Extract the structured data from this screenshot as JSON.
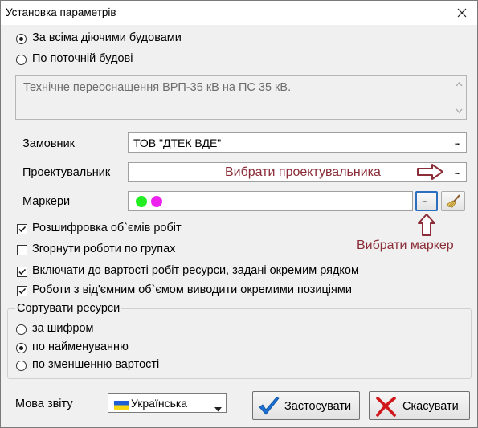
{
  "window": {
    "title": "Установка параметрів"
  },
  "scope": {
    "option_all": "За всіма діючими будовами",
    "option_current": "По поточній будові",
    "selected": "all",
    "description": "Технічне переоснащення ВРП-35 кВ на ПС 35 кВ."
  },
  "fields": {
    "customer_label": "Замовник",
    "customer_value": "ТОВ \"ДТЕК ВДЕ\"",
    "designer_label": "Проектувальник",
    "designer_value": "",
    "markers_label": "Маркери",
    "marker_colors": [
      "#22ee22",
      "#ee22ee"
    ],
    "dots_label": "..."
  },
  "annotations": {
    "choose_designer": "Вибрати проектувальника",
    "choose_marker": "Вибрати маркер"
  },
  "options": [
    {
      "label": "Розшифровка об`ємів робіт",
      "checked": true
    },
    {
      "label": "Згорнути роботи по групах",
      "checked": false
    },
    {
      "label": "Включати до вартості робіт ресурси, задані окремим рядком",
      "checked": true
    },
    {
      "label": "Роботи з від'ємним об`ємом виводити окремими позиціями",
      "checked": true
    }
  ],
  "sort": {
    "title": "Сортувати ресурси",
    "items": [
      "за шифром",
      "по найменуванню",
      "по зменшенню вартості"
    ],
    "selected_index": 1
  },
  "footer": {
    "language_label": "Мова звіту",
    "language_value": "Українська",
    "apply_label": "Застосувати",
    "cancel_label": "Скасувати"
  },
  "colors": {
    "annotation": "#8b2d38",
    "apply_check": "#1a6fd1",
    "cancel_x": "#d0171b"
  }
}
